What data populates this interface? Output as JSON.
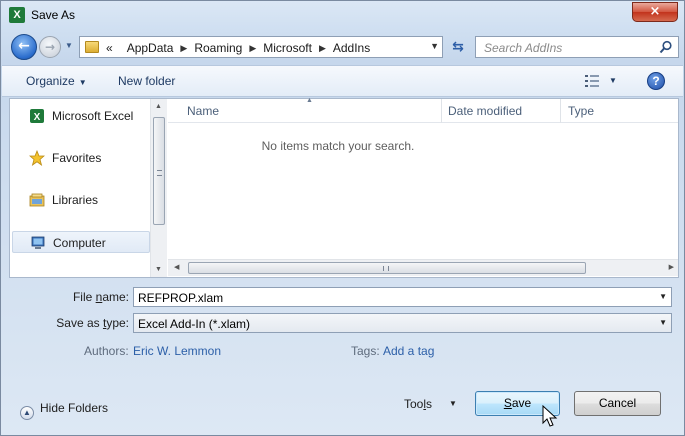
{
  "window": {
    "title": "Save As",
    "app_icon_letter": "X",
    "close_label": "×"
  },
  "address": {
    "overflow_glyph": "«",
    "crumbs": [
      "AppData",
      "Roaming",
      "Microsoft",
      "AddIns"
    ],
    "separator_glyph": "▶"
  },
  "search": {
    "placeholder": "Search AddIns"
  },
  "toolbar": {
    "organize_label": "Organize",
    "new_folder_label": "New folder",
    "help_label": "?"
  },
  "nav": {
    "items": [
      {
        "label": "Microsoft Excel",
        "icon": "excel-icon"
      },
      {
        "label": "Favorites",
        "icon": "star-icon"
      },
      {
        "label": "Libraries",
        "icon": "libraries-icon"
      },
      {
        "label": "Computer",
        "icon": "computer-icon",
        "selected": true
      }
    ]
  },
  "files": {
    "columns": [
      "Name",
      "Date modified",
      "Type"
    ],
    "empty_message": "No items match your search.",
    "items": []
  },
  "form": {
    "file_name_label_pre": "File ",
    "file_name_label_u": "n",
    "file_name_label_post": "ame:",
    "file_name_value": "REFPROP.xlam",
    "save_type_label_pre": "Save as ",
    "save_type_label_u": "t",
    "save_type_label_post": "ype:",
    "save_type_value": "Excel Add-In (*.xlam)",
    "authors_label": "Authors:",
    "authors_value": "Eric W. Lemmon",
    "tags_label": "Tags:",
    "tags_value": "Add a tag"
  },
  "footer": {
    "hide_folders_label": "Hide Folders",
    "tools_pre": "Too",
    "tools_u": "l",
    "tools_post": "s",
    "save_u": "S",
    "save_rest": "ave",
    "cancel_label": "Cancel"
  },
  "colors": {
    "accent": "#2c5fa8",
    "save_button": "#bee6fd",
    "close_button": "#c2331c"
  }
}
